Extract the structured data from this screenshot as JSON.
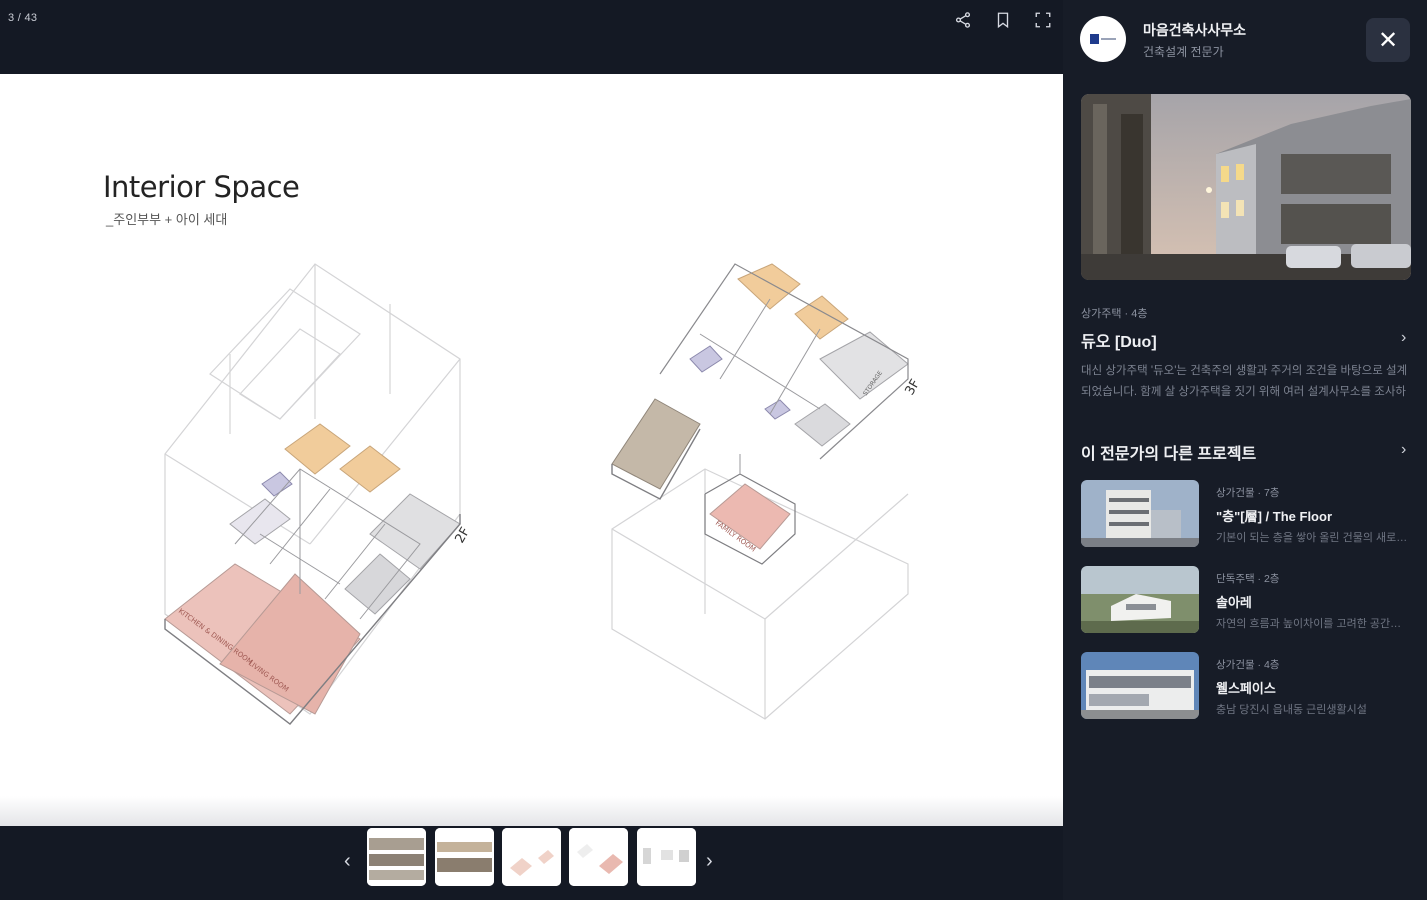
{
  "viewer": {
    "counter": "3 / 43",
    "slide": {
      "title": "Interior Space",
      "subtitle": "_주인부부 + 아이 세대",
      "floor_labels": [
        "2F",
        "3F"
      ],
      "room_labels": [
        "KITCHEN & DINING ROOM",
        "LIVING ROOM",
        "FAMILY ROOM",
        "STORAGE"
      ]
    },
    "icons": [
      "share-icon",
      "bookmark-icon",
      "fullscreen-icon",
      "chevron-left-icon",
      "chevron-right-icon"
    ],
    "thumbnails_count": 5
  },
  "panel": {
    "office_name": "마음건축사사무소",
    "office_subtitle": "건축설계 전문가",
    "close_label": "✕",
    "project": {
      "meta": "상가주택 · 4층",
      "title": "듀오 [Duo]",
      "description": "대신 상가주택 '듀오'는 건축주의 생활과 주거의 조건을 바탕으로 설계되었습니다. 함께 살 상가주택을 짓기 위해 여러 설계사무소를 조사하시..."
    },
    "related_title": "이 전문가의 다른 프로젝트",
    "related": [
      {
        "meta": "상가건물 · 7층",
        "title": "\"층\"[層] / The Floor",
        "desc": "기본이 되는 층을 쌓아 올린 건물의 새로운 해석..."
      },
      {
        "meta": "단독주택 · 2층",
        "title": "솔아레",
        "desc": "자연의 흐름과 높이차이를 고려한 공간의 구성..."
      },
      {
        "meta": "상가건물 · 4층",
        "title": "웰스페이스",
        "desc": "충남 당진시 읍내동 근린생활시설"
      }
    ]
  },
  "colors": {
    "background": "#171c27",
    "accent_pink": "#ebc0b8",
    "accent_orange": "#f2cf9f"
  }
}
